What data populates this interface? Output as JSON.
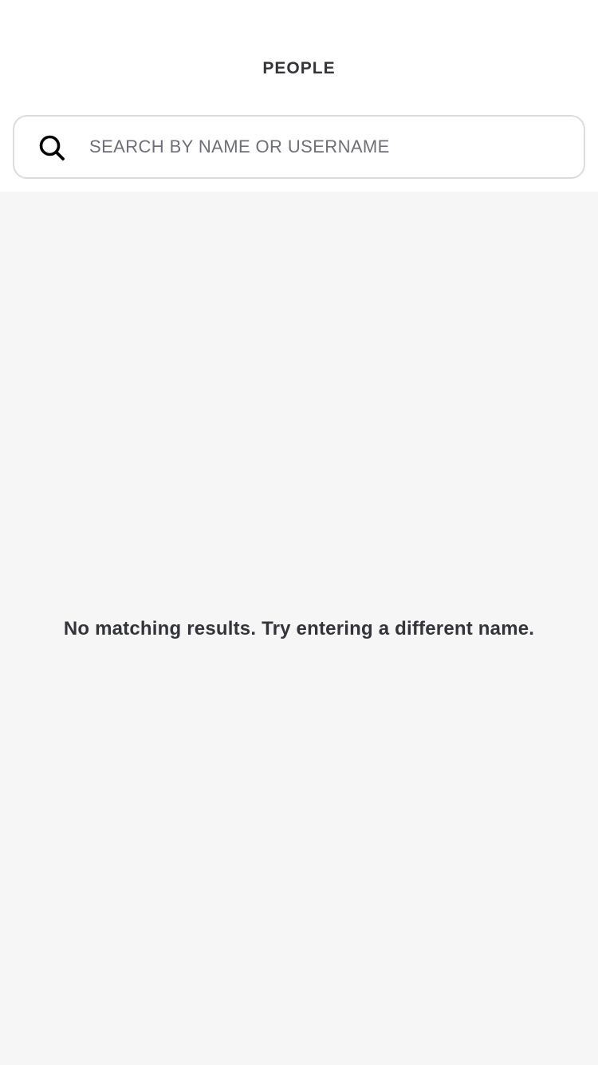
{
  "header": {
    "title": "PEOPLE"
  },
  "search": {
    "icon": "search-icon",
    "placeholder": "SEARCH BY NAME OR USERNAME",
    "value": ""
  },
  "results": {
    "empty_message": "No matching results. Try entering a different name."
  },
  "colors": {
    "text": "#34353a",
    "placeholder": "#6e6f76",
    "border": "#dcdcde",
    "content_background": "#f6f6f6",
    "header_background": "#ffffff"
  }
}
